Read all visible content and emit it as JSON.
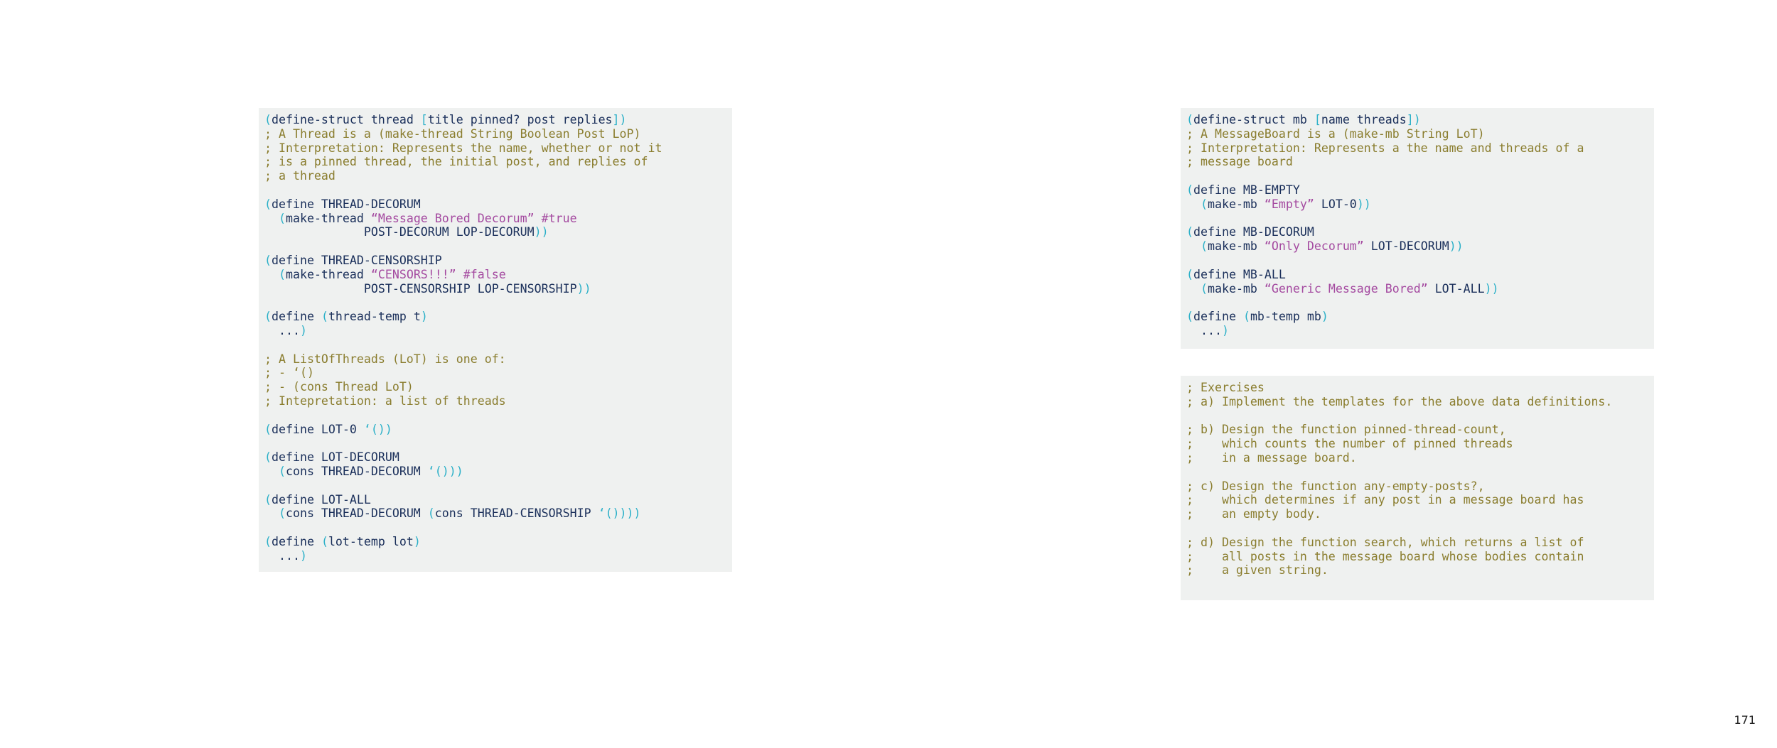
{
  "page_number": "171",
  "colors": {
    "background": "#eff1f0",
    "comment": "#8a7d2e",
    "string": "#a44aa0",
    "paren": "#2bb0c8",
    "code": "#1a2f5a"
  },
  "code_blocks": [
    {
      "name": "thread-definitions",
      "lines": [
        [
          [
            "p",
            "("
          ],
          [
            "t",
            "define-struct thread "
          ],
          [
            "p",
            "["
          ],
          [
            "t",
            "title pinned? post replies"
          ],
          [
            "p",
            "])"
          ]
        ],
        [
          [
            "c",
            "; A Thread is a (make-thread String Boolean Post LoP)"
          ]
        ],
        [
          [
            "c",
            "; Interpretation: Represents the name, whether or not it"
          ]
        ],
        [
          [
            "c",
            "; is a pinned thread, the initial post, and replies of"
          ]
        ],
        [
          [
            "c",
            "; a thread"
          ]
        ],
        [],
        [
          [
            "p",
            "("
          ],
          [
            "t",
            "define THREAD-DECORUM"
          ]
        ],
        [
          [
            "t",
            "  "
          ],
          [
            "p",
            "("
          ],
          [
            "t",
            "make-thread "
          ],
          [
            "s",
            "“Message Bored Decorum” #true"
          ]
        ],
        [
          [
            "t",
            "              POST-DECORUM LOP-DECORUM"
          ],
          [
            "p",
            "))"
          ]
        ],
        [],
        [
          [
            "p",
            "("
          ],
          [
            "t",
            "define THREAD-CENSORSHIP"
          ]
        ],
        [
          [
            "t",
            "  "
          ],
          [
            "p",
            "("
          ],
          [
            "t",
            "make-thread "
          ],
          [
            "s",
            "“CENSORS!!!” #false"
          ]
        ],
        [
          [
            "t",
            "              POST-CENSORSHIP LOP-CENSORSHIP"
          ],
          [
            "p",
            "))"
          ]
        ],
        [],
        [
          [
            "p",
            "("
          ],
          [
            "t",
            "define "
          ],
          [
            "p",
            "("
          ],
          [
            "t",
            "thread-temp t"
          ],
          [
            "p",
            ")"
          ]
        ],
        [
          [
            "t",
            "  ..."
          ],
          [
            "p",
            ")"
          ]
        ],
        [],
        [
          [
            "c",
            "; A ListOfThreads (LoT) is one of:"
          ]
        ],
        [
          [
            "c",
            "; - ‘()"
          ]
        ],
        [
          [
            "c",
            "; - (cons Thread LoT)"
          ]
        ],
        [
          [
            "c",
            "; Intepretation: a list of threads"
          ]
        ],
        [],
        [
          [
            "p",
            "("
          ],
          [
            "t",
            "define LOT-0 "
          ],
          [
            "p",
            "‘())"
          ]
        ],
        [],
        [
          [
            "p",
            "("
          ],
          [
            "t",
            "define LOT-DECORUM"
          ]
        ],
        [
          [
            "t",
            "  "
          ],
          [
            "p",
            "("
          ],
          [
            "t",
            "cons THREAD-DECORUM "
          ],
          [
            "p",
            "‘()))"
          ]
        ],
        [],
        [
          [
            "p",
            "("
          ],
          [
            "t",
            "define LOT-ALL"
          ]
        ],
        [
          [
            "t",
            "  "
          ],
          [
            "p",
            "("
          ],
          [
            "t",
            "cons THREAD-DECORUM "
          ],
          [
            "p",
            "("
          ],
          [
            "t",
            "cons THREAD-CENSORSHIP "
          ],
          [
            "p",
            "‘())))"
          ]
        ],
        [],
        [
          [
            "p",
            "("
          ],
          [
            "t",
            "define "
          ],
          [
            "p",
            "("
          ],
          [
            "t",
            "lot-temp lot"
          ],
          [
            "p",
            ")"
          ]
        ],
        [
          [
            "t",
            "  ..."
          ],
          [
            "p",
            ")"
          ]
        ]
      ]
    },
    {
      "name": "messageboard-definitions",
      "lines": [
        [
          [
            "p",
            "("
          ],
          [
            "t",
            "define-struct mb "
          ],
          [
            "p",
            "["
          ],
          [
            "t",
            "name threads"
          ],
          [
            "p",
            "])"
          ]
        ],
        [
          [
            "c",
            "; A MessageBoard is a (make-mb String LoT)"
          ]
        ],
        [
          [
            "c",
            "; Interpretation: Represents a the name and threads of a"
          ]
        ],
        [
          [
            "c",
            "; message board"
          ]
        ],
        [],
        [
          [
            "p",
            "("
          ],
          [
            "t",
            "define MB-EMPTY"
          ]
        ],
        [
          [
            "t",
            "  "
          ],
          [
            "p",
            "("
          ],
          [
            "t",
            "make-mb "
          ],
          [
            "s",
            "“Empty”"
          ],
          [
            "t",
            " LOT-0"
          ],
          [
            "p",
            "))"
          ]
        ],
        [],
        [
          [
            "p",
            "("
          ],
          [
            "t",
            "define MB-DECORUM"
          ]
        ],
        [
          [
            "t",
            "  "
          ],
          [
            "p",
            "("
          ],
          [
            "t",
            "make-mb "
          ],
          [
            "s",
            "“Only Decorum”"
          ],
          [
            "t",
            " LOT-DECORUM"
          ],
          [
            "p",
            "))"
          ]
        ],
        [],
        [
          [
            "p",
            "("
          ],
          [
            "t",
            "define MB-ALL"
          ]
        ],
        [
          [
            "t",
            "  "
          ],
          [
            "p",
            "("
          ],
          [
            "t",
            "make-mb "
          ],
          [
            "s",
            "“Generic Message Bored”"
          ],
          [
            "t",
            " LOT-ALL"
          ],
          [
            "p",
            "))"
          ]
        ],
        [],
        [
          [
            "p",
            "("
          ],
          [
            "t",
            "define "
          ],
          [
            "p",
            "("
          ],
          [
            "t",
            "mb-temp mb"
          ],
          [
            "p",
            ")"
          ]
        ],
        [
          [
            "t",
            "  ..."
          ],
          [
            "p",
            ")"
          ]
        ]
      ]
    },
    {
      "name": "exercises",
      "lines": [
        [
          [
            "c",
            "; Exercises"
          ]
        ],
        [
          [
            "c",
            "; a) Implement the templates for the above data definitions."
          ]
        ],
        [],
        [
          [
            "c",
            "; b) Design the function pinned-thread-count,"
          ]
        ],
        [
          [
            "c",
            ";    which counts the number of pinned threads"
          ]
        ],
        [
          [
            "c",
            ";    in a message board."
          ]
        ],
        [],
        [
          [
            "c",
            "; c) Design the function any-empty-posts?,"
          ]
        ],
        [
          [
            "c",
            ";    which determines if any post in a message board has"
          ]
        ],
        [
          [
            "c",
            ";    an empty body."
          ]
        ],
        [],
        [
          [
            "c",
            "; d) Design the function search, which returns a list of"
          ]
        ],
        [
          [
            "c",
            ";    all posts in the message board whose bodies contain"
          ]
        ],
        [
          [
            "c",
            ";    a given string."
          ]
        ]
      ]
    }
  ]
}
